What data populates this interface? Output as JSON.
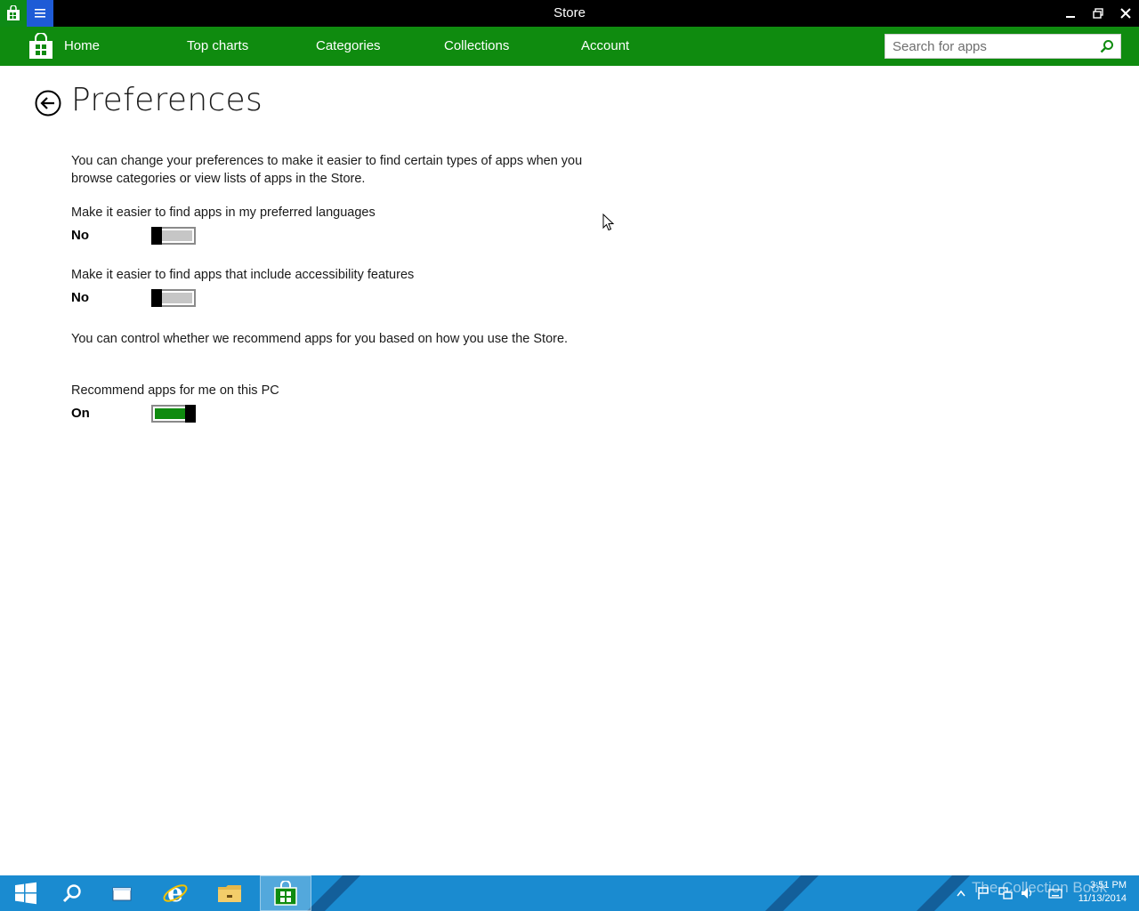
{
  "window": {
    "title": "Store",
    "minimize_icon": "minimize-icon",
    "restore_icon": "restore-icon",
    "close_icon": "close-icon"
  },
  "nav": {
    "items": [
      {
        "label": "Home"
      },
      {
        "label": "Top charts"
      },
      {
        "label": "Categories"
      },
      {
        "label": "Collections"
      },
      {
        "label": "Account"
      }
    ],
    "search_placeholder": "Search for apps",
    "accent_color": "#0f8b0f"
  },
  "page": {
    "title": "Preferences",
    "intro": "You can change your preferences to make it easier to find certain types of apps when you browse categories or view lists of apps in the Store.",
    "settings": [
      {
        "label": "Make it easier to find apps in my preferred languages",
        "state_text": "No",
        "on": false
      },
      {
        "label": "Make it easier to find apps that include accessibility features",
        "state_text": "No",
        "on": false
      }
    ],
    "recommend_intro": "You can control whether we recommend apps for you based on how you use the Store.",
    "recommend_setting": {
      "label": "Recommend apps for me on this PC",
      "state_text": "On",
      "on": true
    }
  },
  "taskbar": {
    "apps": [
      "start-icon",
      "search-icon",
      "task-view-icon",
      "internet-explorer-icon",
      "file-explorer-icon",
      "store-icon"
    ],
    "watermark": "The Collection Book",
    "time": "3:51 PM",
    "date": "11/13/2014",
    "color": "#1a8bd0"
  }
}
